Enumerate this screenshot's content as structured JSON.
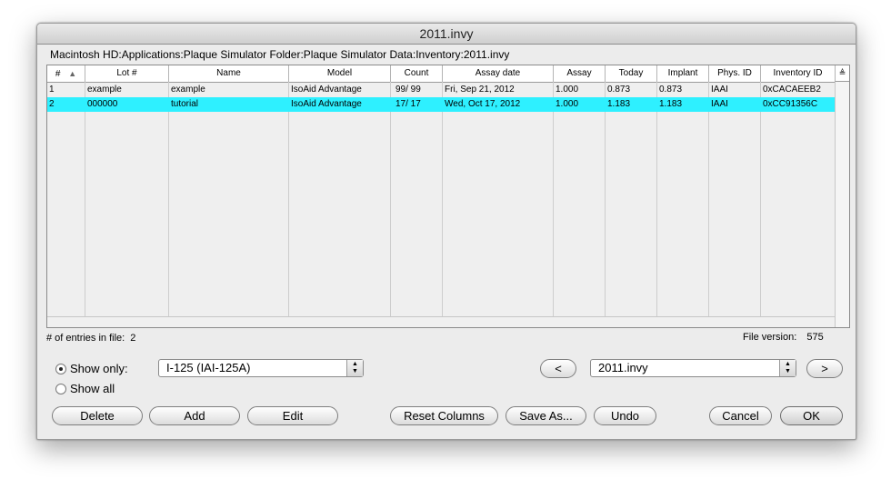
{
  "window": {
    "title": "2011.invy"
  },
  "path": "Macintosh HD:Applications:Plaque Simulator Folder:Plaque Simulator Data:Inventory:2011.invy",
  "table": {
    "columns": [
      "#",
      "Lot #",
      "Name",
      "Model",
      "Count",
      "Assay date",
      "Assay",
      "Today",
      "Implant",
      "Phys. ID",
      "Inventory ID"
    ],
    "rows": [
      [
        "1",
        "example",
        "example",
        "IsoAid Advantage",
        "99/ 99",
        "Fri, Sep 21, 2012",
        "1.000",
        "0.873",
        "0.873",
        "IAAI",
        "0xCACAEEB2"
      ],
      [
        "2",
        "000000",
        "tutorial",
        "IsoAid Advantage",
        "17/ 17",
        "Wed, Oct 17, 2012",
        "1.000",
        "1.183",
        "1.183",
        "IAAI",
        "0xCC91356C"
      ]
    ],
    "selected_row": 1,
    "sort_indicator": "▲",
    "corner_icon": "≜"
  },
  "status": {
    "entries_label": "# of entries in file:",
    "entries_value": "2",
    "version_label": "File version:",
    "version_value": "575"
  },
  "filter": {
    "show_only_label": "Show only:",
    "show_all_label": "Show all",
    "show_only_checked": true,
    "isotope_value": "I-125 (IAI-125A)"
  },
  "nav": {
    "prev_label": "<",
    "file_value": "2011.invy",
    "next_label": ">"
  },
  "buttons": {
    "delete": "Delete",
    "add": "Add",
    "edit": "Edit",
    "reset_columns": "Reset Columns",
    "save_as": "Save As...",
    "undo": "Undo",
    "cancel": "Cancel",
    "ok": "OK"
  },
  "icons": {
    "popup_arrows": "▲▼"
  }
}
